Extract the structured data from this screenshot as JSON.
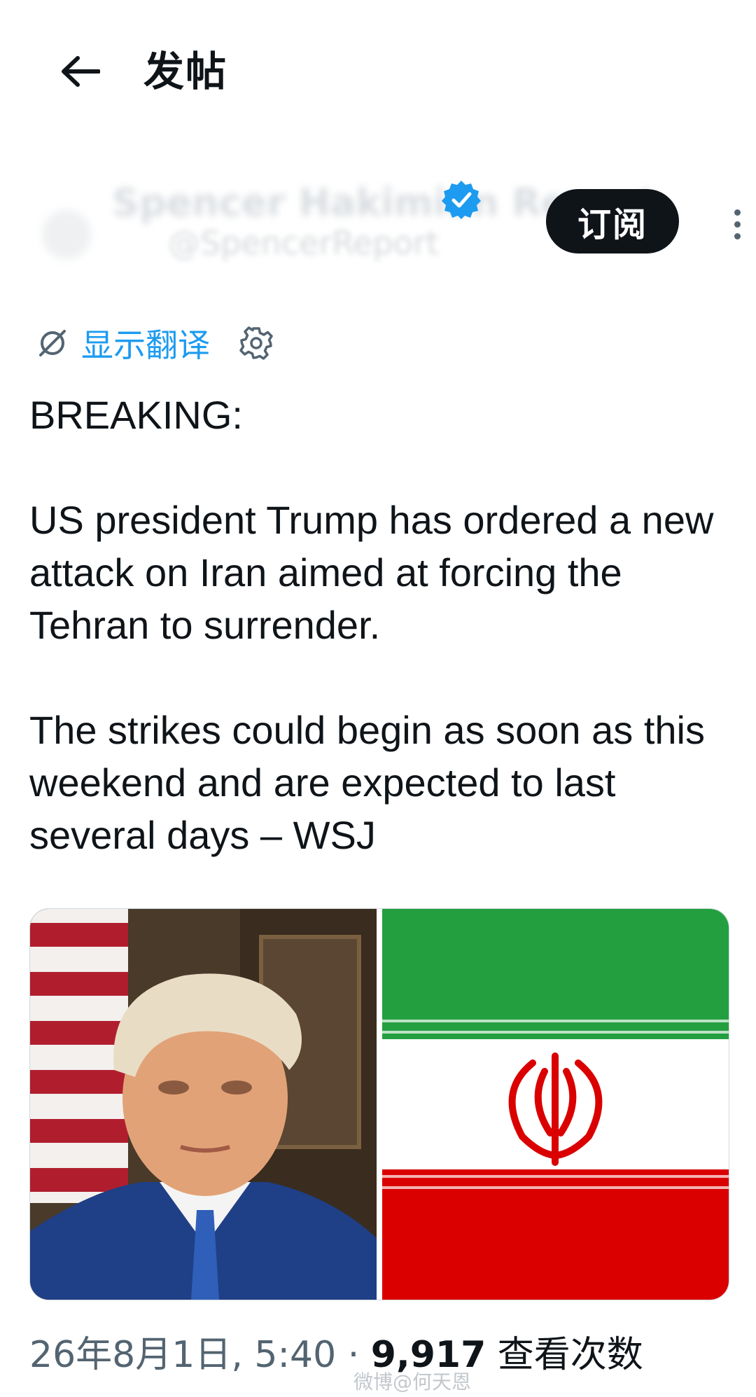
{
  "header": {
    "title": "发帖",
    "back_icon": "arrow-left-icon"
  },
  "author": {
    "display_name": "Spencer Hakimian Report",
    "handle": "@SpencerReport",
    "verified_color": "#1d9bf0",
    "subscribe_label": "订阅"
  },
  "translate": {
    "label": "显示翻译",
    "color": "#1d9bf0"
  },
  "tweet": {
    "lines": [
      "BREAKING:",
      "US president Trump has ordered a new attack on Iran aimed at forcing the Tehran to surrender.",
      "The strikes could begin as soon as this weekend and are expected to last several days – WSJ"
    ]
  },
  "media": [
    {
      "name": "trump-portrait"
    },
    {
      "name": "iran-flag",
      "colors": {
        "green": "#239f40",
        "white": "#ffffff",
        "red": "#da0000"
      }
    }
  ],
  "meta": {
    "date": "26年8月1日",
    "time": "5:40",
    "separator": "·",
    "views_count": "9,917",
    "views_label": "查看次数"
  },
  "watermark": "微博@何天恩"
}
